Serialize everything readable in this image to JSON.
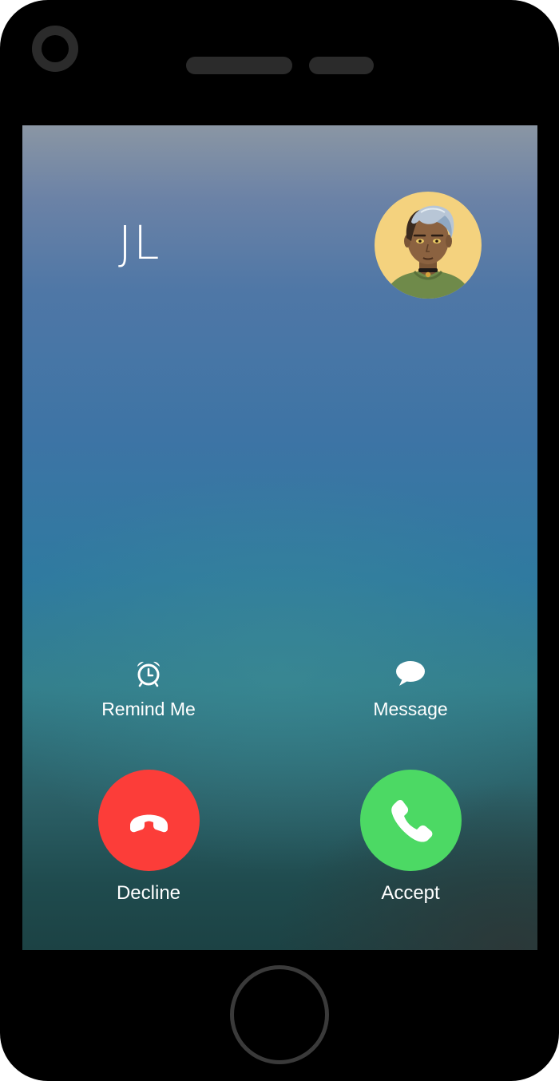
{
  "call": {
    "caller_name": "JL",
    "avatar_icon": "caller-avatar-illustration"
  },
  "actions": {
    "remind_label": "Remind Me",
    "remind_icon": "alarm-clock-icon",
    "message_label": "Message",
    "message_icon": "speech-bubble-icon",
    "decline_label": "Decline",
    "decline_icon": "phone-hangup-icon",
    "accept_label": "Accept",
    "accept_icon": "phone-icon"
  },
  "colors": {
    "decline": "#fc3d39",
    "accept": "#4cd964",
    "avatar_bg": "#f4d27e"
  }
}
